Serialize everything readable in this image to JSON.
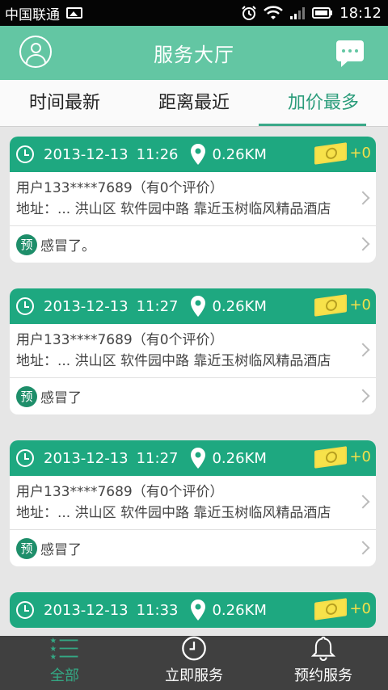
{
  "status_bar": {
    "carrier": "中国联通",
    "time": "18:12"
  },
  "header": {
    "title": "服务大厅"
  },
  "tabs": [
    {
      "label": "时间最新",
      "active": false
    },
    {
      "label": "距离最近",
      "active": false
    },
    {
      "label": "加价最多",
      "active": true
    }
  ],
  "orders": [
    {
      "date": "2013-12-13",
      "time": "11:26",
      "distance": "0.26KM",
      "markup": "+0",
      "user": "用户133****7689（有0个评价）",
      "address": "地址：... 洪山区 软件园中路 靠近玉树临风精品酒店",
      "badge": "预",
      "note": "感冒了。"
    },
    {
      "date": "2013-12-13",
      "time": "11:27",
      "distance": "0.26KM",
      "markup": "+0",
      "user": "用户133****7689（有0个评价）",
      "address": "地址：... 洪山区 软件园中路 靠近玉树临风精品酒店",
      "badge": "预",
      "note": "感冒了"
    },
    {
      "date": "2013-12-13",
      "time": "11:27",
      "distance": "0.26KM",
      "markup": "+0",
      "user": "用户133****7689（有0个评价）",
      "address": "地址：... 洪山区 软件园中路 靠近玉树临风精品酒店",
      "badge": "预",
      "note": "感冒了"
    },
    {
      "date": "2013-12-13",
      "time": "11:33",
      "distance": "0.26KM",
      "markup": "+0"
    }
  ],
  "bottom_nav": [
    {
      "label": "全部",
      "icon": "list-icon",
      "active": true
    },
    {
      "label": "立即服务",
      "icon": "clock-icon",
      "active": false
    },
    {
      "label": "预约服务",
      "icon": "bell-icon",
      "active": false
    }
  ],
  "colors": {
    "header_bg": "#63c6a3",
    "card_header_bg": "#1ea880",
    "active_tab": "#2a9c7a",
    "bottom_bar_bg": "#404040"
  }
}
